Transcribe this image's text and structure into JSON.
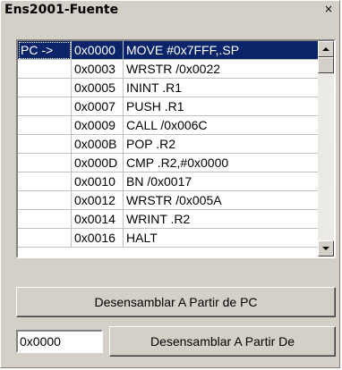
{
  "window": {
    "title": "Ens2001-Fuente",
    "close_glyph": "×"
  },
  "listing": {
    "rows": [
      {
        "marker": "PC ->",
        "address": "0x0000",
        "instruction": "MOVE #0x7FFF,.SP",
        "selected": true
      },
      {
        "marker": "",
        "address": "0x0003",
        "instruction": "WRSTR /0x0022",
        "selected": false
      },
      {
        "marker": "",
        "address": "0x0005",
        "instruction": "ININT .R1",
        "selected": false
      },
      {
        "marker": "",
        "address": "0x0007",
        "instruction": "PUSH .R1",
        "selected": false
      },
      {
        "marker": "",
        "address": "0x0009",
        "instruction": "CALL /0x006C",
        "selected": false
      },
      {
        "marker": "",
        "address": "0x000B",
        "instruction": "POP .R2",
        "selected": false
      },
      {
        "marker": "",
        "address": "0x000D",
        "instruction": "CMP .R2,#0x0000",
        "selected": false
      },
      {
        "marker": "",
        "address": "0x0010",
        "instruction": "BN /0x0017",
        "selected": false
      },
      {
        "marker": "",
        "address": "0x0012",
        "instruction": "WRSTR /0x005A",
        "selected": false
      },
      {
        "marker": "",
        "address": "0x0014",
        "instruction": "WRINT .R2",
        "selected": false
      },
      {
        "marker": "",
        "address": "0x0016",
        "instruction": "HALT",
        "selected": false
      }
    ]
  },
  "buttons": {
    "disassemble_pc": "Desensamblar A Partir de PC",
    "disassemble_from": "Desensamblar A Partir De"
  },
  "address_input": {
    "value": "0x0000"
  },
  "colors": {
    "selection": "#0a246a",
    "face": "#d4d0c8"
  }
}
